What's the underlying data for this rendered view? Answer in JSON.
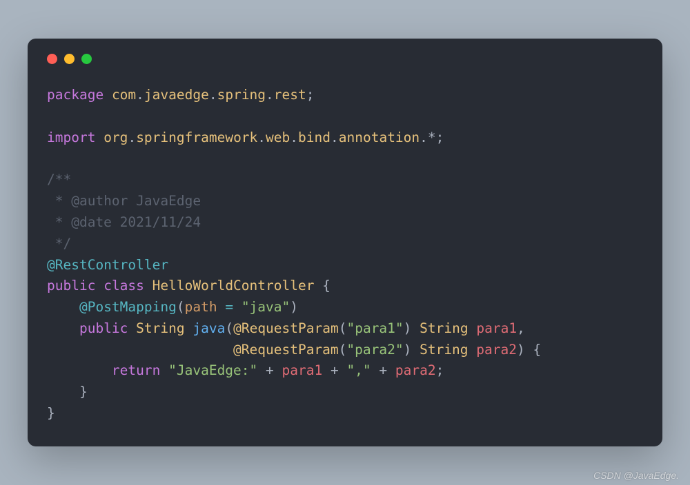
{
  "code": {
    "line1": {
      "package": "package",
      "parts": [
        "com",
        "javaedge",
        "spring",
        "rest"
      ],
      "semi": ";"
    },
    "line2": {
      "import": "import",
      "parts": [
        "org",
        "springframework",
        "web",
        "bind",
        "annotation"
      ],
      "wildcard": "*",
      "semi": ";"
    },
    "comment": {
      "l1": "/**",
      "l2": " * @author JavaEdge",
      "l3": " * @date 2021/11/24",
      "l4": " */"
    },
    "anno1": "@RestController",
    "classDecl": {
      "public": "public",
      "class": "class",
      "name": "HelloWorldController",
      "brace": " {"
    },
    "anno2": {
      "at": "@PostMapping",
      "lp": "(",
      "key": "path",
      "eq": " = ",
      "val": "\"java\"",
      "rp": ")"
    },
    "methodDecl": {
      "public": "public",
      "type": "String",
      "name": "java",
      "lp": "(",
      "anno": "@RequestParam",
      "ap1lp": "(",
      "ap1v": "\"para1\"",
      "ap1rp": ")",
      "ptype": "String",
      "pname1": "para1",
      "comma": ", "
    },
    "methodDecl2": {
      "anno": "@RequestParam",
      "ap2lp": "(",
      "ap2v": "\"para2\"",
      "ap2rp": ")",
      "ptype": "String",
      "pname2": "para2",
      "rp": ")",
      "brace": " {"
    },
    "ret": {
      "return": "return",
      "s1": "\"JavaEdge:\"",
      "plus": " + ",
      "v1": "para1",
      "s2": "\",\"",
      "v2": "para2",
      "semi": ";"
    },
    "close1": "    }",
    "close2": "}"
  },
  "watermark": "CSDN @JavaEdge."
}
